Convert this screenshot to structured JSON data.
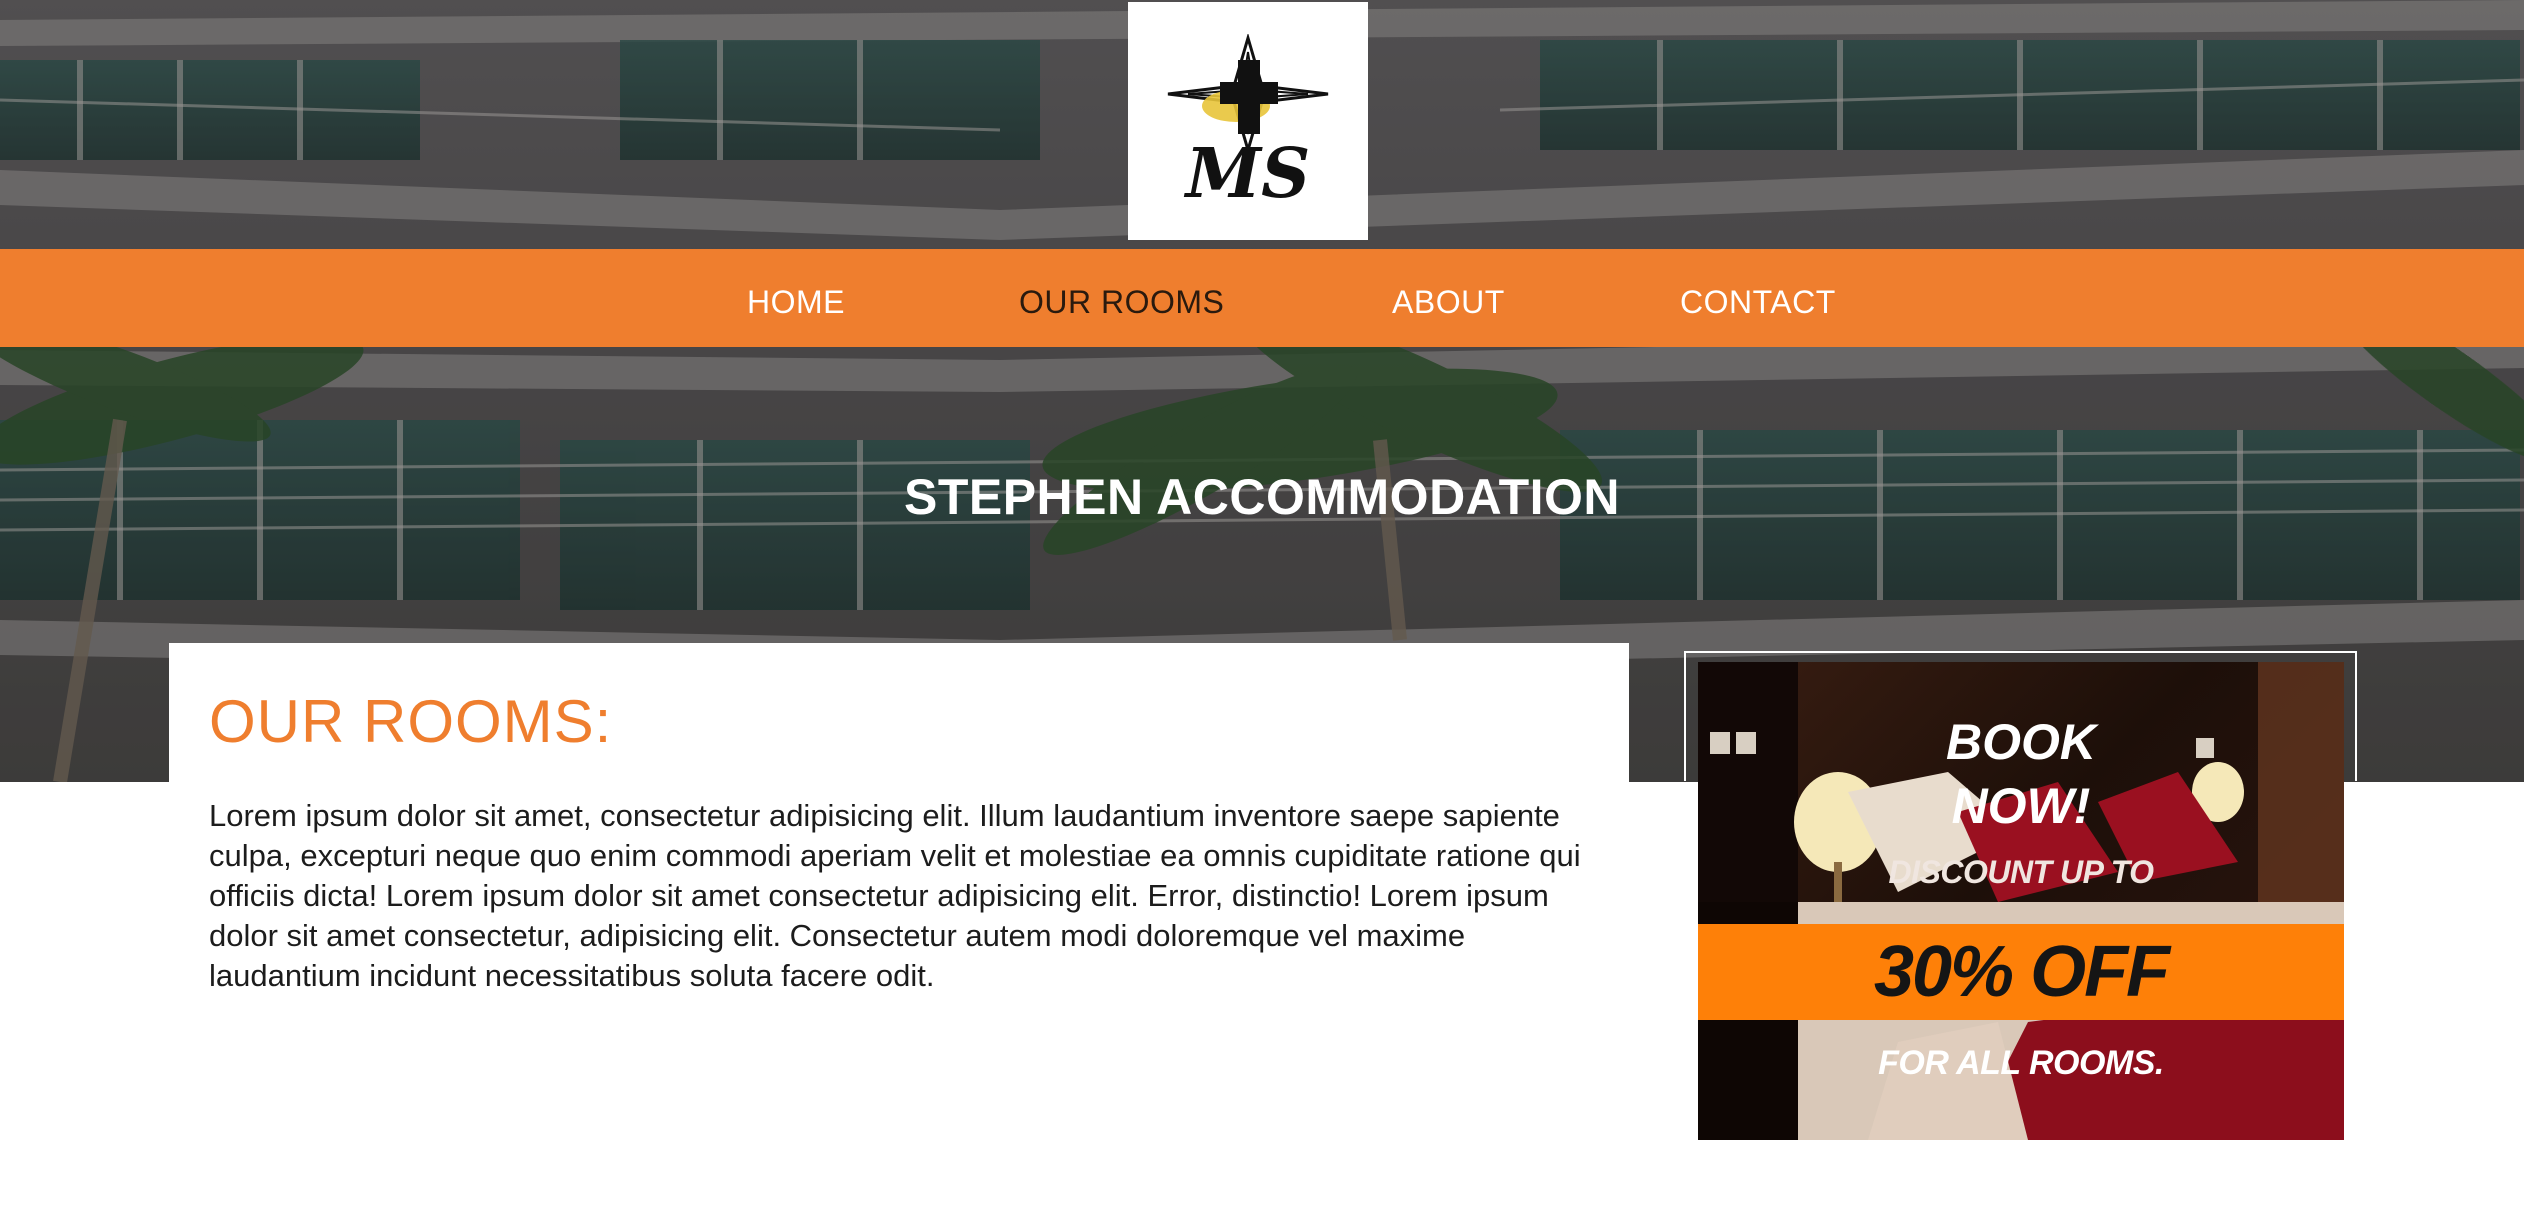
{
  "logo": {
    "initials": "MS",
    "accent_color": "#e8c43a"
  },
  "nav": {
    "items": [
      {
        "label": "HOME",
        "active": false
      },
      {
        "label": "OUR ROOMS",
        "active": true
      },
      {
        "label": "ABOUT",
        "active": false
      },
      {
        "label": "CONTACT",
        "active": false
      }
    ],
    "background_color": "#ef7e2e"
  },
  "hero": {
    "title": "STEPHEN ACCOMMODATION"
  },
  "rooms": {
    "heading": "OUR ROOMS:",
    "body": "Lorem ipsum dolor sit amet, consectetur adipisicing elit. Illum laudantium inventore saepe sapiente culpa, excepturi neque quo enim commodi aperiam velit et molestiae ea omnis cupiditate ratione qui officiis dicta! Lorem ipsum dolor sit amet consectetur adipisicing elit. Error, distinctio! Lorem ipsum dolor sit amet consectetur, adipisicing elit. Consectetur autem modi doloremque vel maxime laudantium incidunt necessitatibus soluta facere odit.",
    "heading_color": "#ef7e2e"
  },
  "promo": {
    "book_line1": "BOOK",
    "book_line2": "NOW!",
    "discount_text": "DISCOUNT UP TO",
    "percent_text": "30% OFF",
    "all_rooms_text": "FOR ALL ROOMS.",
    "band_color": "#fe8008"
  }
}
